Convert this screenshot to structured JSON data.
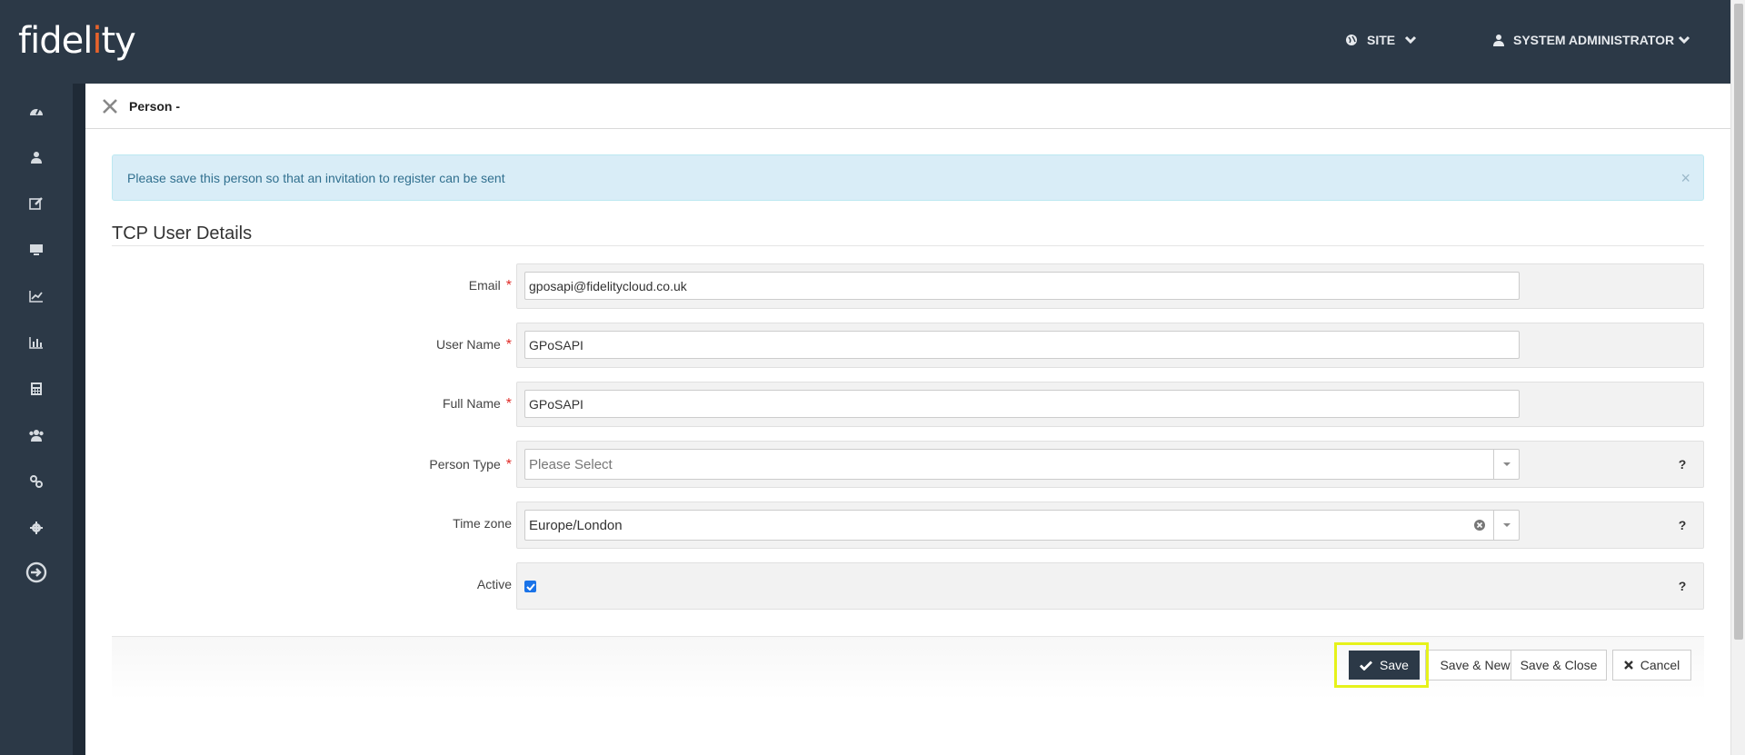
{
  "header": {
    "logo_text_a": "fidel",
    "logo_text_b": "i",
    "logo_text_c": "ty",
    "site_label": "SITE",
    "user_label": "SYSTEM ADMINISTRATOR"
  },
  "sidebar": {
    "items": [
      "dashboard-icon",
      "person-icon",
      "edit-icon",
      "monitor-icon",
      "line-chart-icon",
      "bar-chart-icon",
      "calculator-icon",
      "group-icon",
      "link-icon",
      "gear-icon",
      "logout-icon"
    ]
  },
  "page": {
    "title": "Person -",
    "alert": "Please save this person so that an invitation to register can be sent",
    "alert_close": "×",
    "section_title": "TCP User Details"
  },
  "form": {
    "email_label": "Email",
    "email_value": "gposapi@fidelitycloud.co.uk",
    "username_label": "User Name",
    "username_value": "GPoSAPI",
    "fullname_label": "Full Name",
    "fullname_value": "GPoSAPI",
    "persontype_label": "Person Type",
    "persontype_placeholder": "Please Select",
    "timezone_label": "Time zone",
    "timezone_value": "Europe/London",
    "active_label": "Active",
    "active_checked": true,
    "required_mark": "*",
    "help": "?"
  },
  "actions": {
    "save": "Save",
    "save_new": "Save & New",
    "save_close": "Save & Close",
    "cancel": "Cancel"
  },
  "colors": {
    "nav_bg": "#2c3947",
    "accent": "#e8632b",
    "highlight": "#e6f21a"
  }
}
